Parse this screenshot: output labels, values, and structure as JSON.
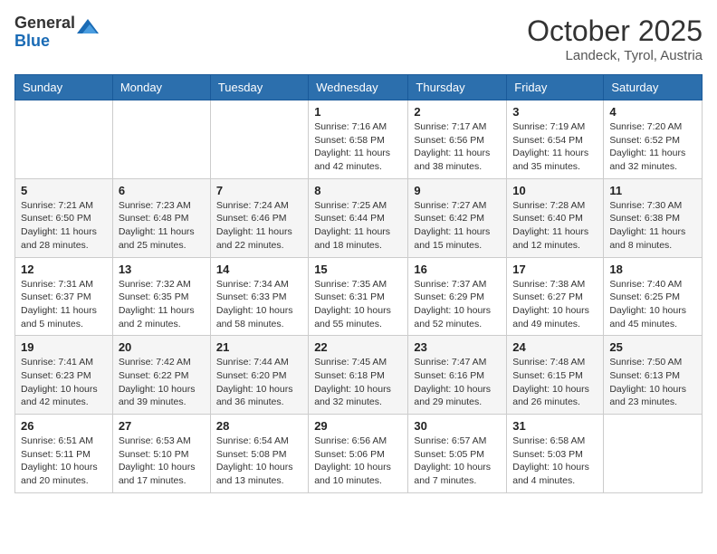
{
  "header": {
    "logo_general": "General",
    "logo_blue": "Blue",
    "month_title": "October 2025",
    "location": "Landeck, Tyrol, Austria"
  },
  "days_of_week": [
    "Sunday",
    "Monday",
    "Tuesday",
    "Wednesday",
    "Thursday",
    "Friday",
    "Saturday"
  ],
  "weeks": [
    [
      {
        "day": "",
        "info": ""
      },
      {
        "day": "",
        "info": ""
      },
      {
        "day": "",
        "info": ""
      },
      {
        "day": "1",
        "info": "Sunrise: 7:16 AM\nSunset: 6:58 PM\nDaylight: 11 hours and 42 minutes."
      },
      {
        "day": "2",
        "info": "Sunrise: 7:17 AM\nSunset: 6:56 PM\nDaylight: 11 hours and 38 minutes."
      },
      {
        "day": "3",
        "info": "Sunrise: 7:19 AM\nSunset: 6:54 PM\nDaylight: 11 hours and 35 minutes."
      },
      {
        "day": "4",
        "info": "Sunrise: 7:20 AM\nSunset: 6:52 PM\nDaylight: 11 hours and 32 minutes."
      }
    ],
    [
      {
        "day": "5",
        "info": "Sunrise: 7:21 AM\nSunset: 6:50 PM\nDaylight: 11 hours and 28 minutes."
      },
      {
        "day": "6",
        "info": "Sunrise: 7:23 AM\nSunset: 6:48 PM\nDaylight: 11 hours and 25 minutes."
      },
      {
        "day": "7",
        "info": "Sunrise: 7:24 AM\nSunset: 6:46 PM\nDaylight: 11 hours and 22 minutes."
      },
      {
        "day": "8",
        "info": "Sunrise: 7:25 AM\nSunset: 6:44 PM\nDaylight: 11 hours and 18 minutes."
      },
      {
        "day": "9",
        "info": "Sunrise: 7:27 AM\nSunset: 6:42 PM\nDaylight: 11 hours and 15 minutes."
      },
      {
        "day": "10",
        "info": "Sunrise: 7:28 AM\nSunset: 6:40 PM\nDaylight: 11 hours and 12 minutes."
      },
      {
        "day": "11",
        "info": "Sunrise: 7:30 AM\nSunset: 6:38 PM\nDaylight: 11 hours and 8 minutes."
      }
    ],
    [
      {
        "day": "12",
        "info": "Sunrise: 7:31 AM\nSunset: 6:37 PM\nDaylight: 11 hours and 5 minutes."
      },
      {
        "day": "13",
        "info": "Sunrise: 7:32 AM\nSunset: 6:35 PM\nDaylight: 11 hours and 2 minutes."
      },
      {
        "day": "14",
        "info": "Sunrise: 7:34 AM\nSunset: 6:33 PM\nDaylight: 10 hours and 58 minutes."
      },
      {
        "day": "15",
        "info": "Sunrise: 7:35 AM\nSunset: 6:31 PM\nDaylight: 10 hours and 55 minutes."
      },
      {
        "day": "16",
        "info": "Sunrise: 7:37 AM\nSunset: 6:29 PM\nDaylight: 10 hours and 52 minutes."
      },
      {
        "day": "17",
        "info": "Sunrise: 7:38 AM\nSunset: 6:27 PM\nDaylight: 10 hours and 49 minutes."
      },
      {
        "day": "18",
        "info": "Sunrise: 7:40 AM\nSunset: 6:25 PM\nDaylight: 10 hours and 45 minutes."
      }
    ],
    [
      {
        "day": "19",
        "info": "Sunrise: 7:41 AM\nSunset: 6:23 PM\nDaylight: 10 hours and 42 minutes."
      },
      {
        "day": "20",
        "info": "Sunrise: 7:42 AM\nSunset: 6:22 PM\nDaylight: 10 hours and 39 minutes."
      },
      {
        "day": "21",
        "info": "Sunrise: 7:44 AM\nSunset: 6:20 PM\nDaylight: 10 hours and 36 minutes."
      },
      {
        "day": "22",
        "info": "Sunrise: 7:45 AM\nSunset: 6:18 PM\nDaylight: 10 hours and 32 minutes."
      },
      {
        "day": "23",
        "info": "Sunrise: 7:47 AM\nSunset: 6:16 PM\nDaylight: 10 hours and 29 minutes."
      },
      {
        "day": "24",
        "info": "Sunrise: 7:48 AM\nSunset: 6:15 PM\nDaylight: 10 hours and 26 minutes."
      },
      {
        "day": "25",
        "info": "Sunrise: 7:50 AM\nSunset: 6:13 PM\nDaylight: 10 hours and 23 minutes."
      }
    ],
    [
      {
        "day": "26",
        "info": "Sunrise: 6:51 AM\nSunset: 5:11 PM\nDaylight: 10 hours and 20 minutes."
      },
      {
        "day": "27",
        "info": "Sunrise: 6:53 AM\nSunset: 5:10 PM\nDaylight: 10 hours and 17 minutes."
      },
      {
        "day": "28",
        "info": "Sunrise: 6:54 AM\nSunset: 5:08 PM\nDaylight: 10 hours and 13 minutes."
      },
      {
        "day": "29",
        "info": "Sunrise: 6:56 AM\nSunset: 5:06 PM\nDaylight: 10 hours and 10 minutes."
      },
      {
        "day": "30",
        "info": "Sunrise: 6:57 AM\nSunset: 5:05 PM\nDaylight: 10 hours and 7 minutes."
      },
      {
        "day": "31",
        "info": "Sunrise: 6:58 AM\nSunset: 5:03 PM\nDaylight: 10 hours and 4 minutes."
      },
      {
        "day": "",
        "info": ""
      }
    ]
  ]
}
